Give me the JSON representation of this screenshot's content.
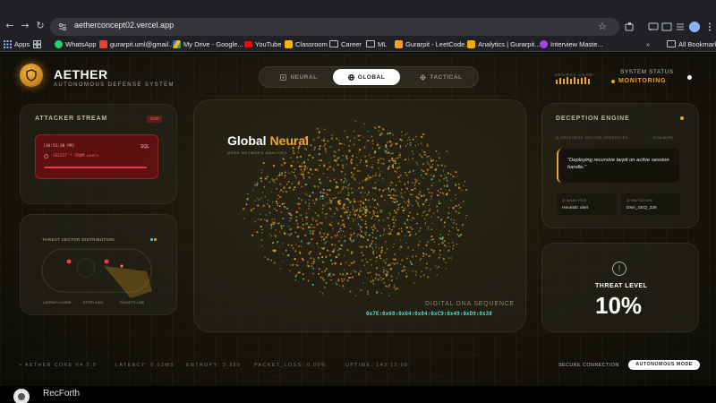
{
  "browser": {
    "url": "aetherconcept02.vercel.app",
    "bookmarks": [
      {
        "label": "Apps",
        "icon": "apps-grid-icon"
      },
      {
        "label": "",
        "icon": "grid-icon"
      },
      {
        "label": "WhatsApp",
        "icon": "whatsapp-icon",
        "color": "#25d366"
      },
      {
        "label": "gurarpit.uml@gmail....",
        "icon": "gmail-icon",
        "color": "#ea4335"
      },
      {
        "label": "My Drive - Google...",
        "icon": "drive-icon",
        "color": "#1a73e8"
      },
      {
        "label": "YouTube",
        "icon": "youtube-icon",
        "color": "#ff0000"
      },
      {
        "label": "Classroom",
        "icon": "classroom-icon",
        "color": "#f4b400"
      },
      {
        "label": "Career",
        "icon": "folder-icon"
      },
      {
        "label": "ML",
        "icon": "folder-icon"
      },
      {
        "label": "Gurarpit - LeetCode...",
        "icon": "leetcode-icon",
        "color": "#ffa116"
      },
      {
        "label": "Analytics | Gurarpit...",
        "icon": "analytics-icon",
        "color": "#f9ab00"
      },
      {
        "label": "Interview Maste...",
        "icon": "rocket-icon",
        "color": "#a142f4"
      }
    ],
    "all_bookmarks": "All Bookmarks"
  },
  "app": {
    "brand": "AETHER",
    "tagline": "AUTONOMOUS DEFENSE SYSTEM",
    "modes": [
      {
        "label": "NEURAL",
        "icon": "neural-icon"
      },
      {
        "label": "GLOBAL",
        "icon": "globe-icon"
      },
      {
        "label": "TACTICAL",
        "icon": "crosshair-icon"
      }
    ],
    "active_mode": "GLOBAL",
    "neural_load_label": "NEURAL LOAD",
    "neural_load_levels": [
      0.6,
      0.9,
      0.7,
      1.0,
      0.8,
      0.95,
      0.7,
      0.85,
      1.0,
      0.75
    ],
    "system_status_label": "SYSTEM STATUS",
    "system_status": "MONITORING",
    "accent": "#e8a428"
  },
  "attacker": {
    "title": "ATTACKER STREAM",
    "live": "LIVE",
    "time": "[10:53:38 PM]",
    "type": "SQL",
    "query": "SELECT * FROM users",
    "threat_vector_title": "THREAT VECTOR DISTRIBUTION",
    "metrics": [
      "LATENCY 0.03MS",
      "JITTER 0.001",
      "PACKETS 1265"
    ]
  },
  "center": {
    "title_a": "Global",
    "title_b": "Neural",
    "subtitle": "MESH NETWORK ANALYSIS",
    "dna_label": "DIGITAL DNA SEQUENCE",
    "dna_value": "0x7E:0x68:0x64:0x84:0xC9:0x49:0xD9:0x38"
  },
  "deception": {
    "title": "DECEPTION ENGINE",
    "response_label": "RESPONSE VECTOR GENERATED",
    "response_time": "09:53:38 PM",
    "quote": "\"Deploying recursive tarpit on active session handle.\"",
    "analysis_label": "ANALYSIS",
    "analysis_value": "Heuristic alert",
    "mutation_label": "MUTATION",
    "mutation_value": "DNA_SEQ_239"
  },
  "threat": {
    "label": "THREAT LEVEL",
    "value": "10%"
  },
  "footer": {
    "core": "• AETHER CORE V4.2.0",
    "latency": "LATENCY: 0.03MS",
    "entropy": "ENTROPY: 3.389",
    "packet_loss": "PACKET_LOSS: 0.00%",
    "uptime": "UPTIME: 143:12:06",
    "secure": "SECURE CONNECTION",
    "autonomous": "AUTONOMOUS MODE"
  },
  "recorder": {
    "label": "RecForth"
  }
}
